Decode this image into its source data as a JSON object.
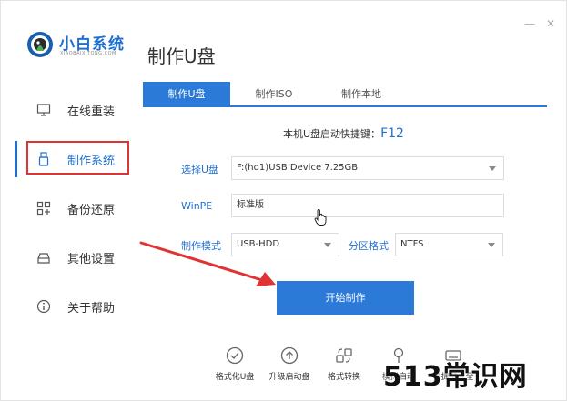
{
  "app": {
    "brand_title": "小白系统",
    "brand_subtitle": "XIAOBAIXITONG.COM",
    "page_title": "制作U盘",
    "minimize_glyph": "—",
    "close_glyph": "✕"
  },
  "sidebar": {
    "items": [
      {
        "label": "在线重装",
        "icon": "monitor-icon"
      },
      {
        "label": "制作系统",
        "icon": "usb-icon"
      },
      {
        "label": "备份还原",
        "icon": "grid-icon"
      },
      {
        "label": "其他设置",
        "icon": "tray-icon"
      },
      {
        "label": "关于帮助",
        "icon": "info-icon"
      }
    ],
    "active_index": 1
  },
  "tabs": [
    {
      "label": "制作U盘"
    },
    {
      "label": "制作ISO"
    },
    {
      "label": "制作本地"
    }
  ],
  "shortcut": {
    "label": "本机U盘启动快捷键：",
    "key": "F12"
  },
  "form": {
    "usb_label": "选择U盘",
    "usb_value": "F:(hd1)USB Device 7.25GB",
    "winpe_label": "WinPE",
    "winpe_value": "标准版",
    "mode_label": "制作模式",
    "mode_value": "USB-HDD",
    "partition_label": "分区格式",
    "partition_value": "NTFS"
  },
  "start_button": "开始制作",
  "tools": [
    {
      "label": "格式化U盘",
      "icon": "check-circle-icon"
    },
    {
      "label": "升级启动盘",
      "icon": "upload-circle-icon"
    },
    {
      "label": "格式转换",
      "icon": "convert-icon"
    },
    {
      "label": "模拟启动",
      "icon": "lightbulb-icon"
    },
    {
      "label": "快捷键大全",
      "icon": "keyboard-icon"
    }
  ],
  "watermark": "513常识网",
  "colors": {
    "accent": "#2b7ad8",
    "highlight": "#e03333"
  }
}
